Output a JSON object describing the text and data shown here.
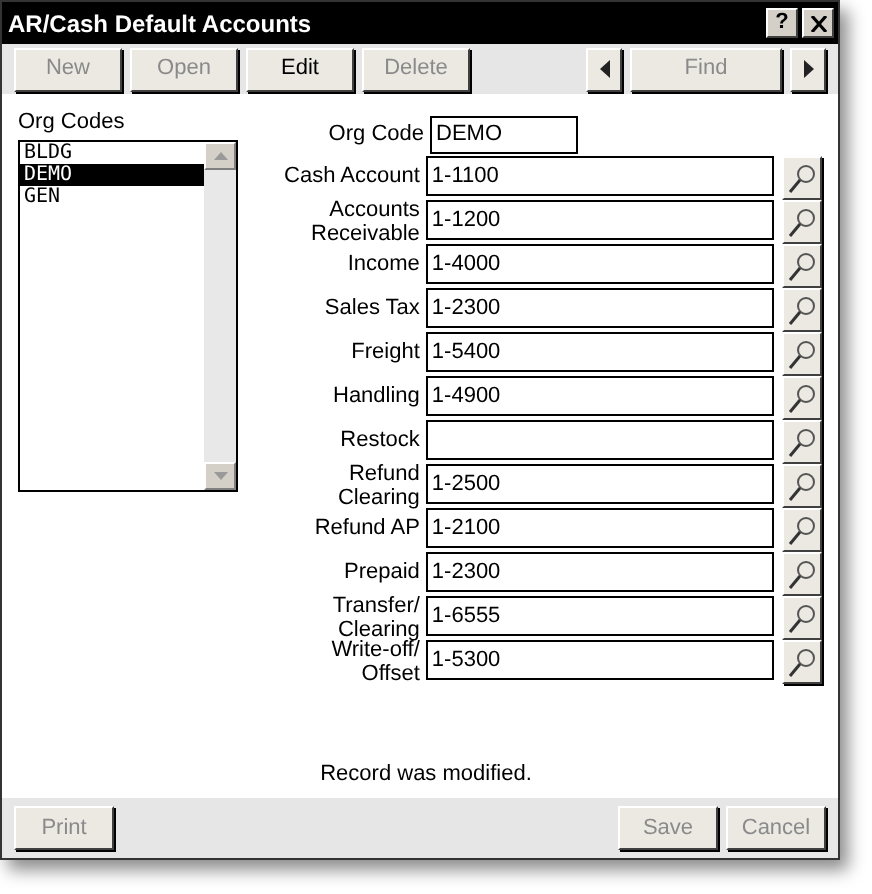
{
  "window": {
    "title": "AR/Cash Default Accounts",
    "help": "?"
  },
  "toolbar": [
    {
      "kind": "button",
      "label": "New",
      "disabled": true
    },
    {
      "kind": "button",
      "label": "Open",
      "disabled": true
    },
    {
      "kind": "button",
      "label": "Edit",
      "disabled": false
    },
    {
      "kind": "button",
      "label": "Delete",
      "disabled": true
    },
    {
      "kind": "spacer"
    },
    {
      "kind": "prev",
      "disabled": false
    },
    {
      "kind": "button",
      "label": "Find",
      "disabled": true
    },
    {
      "kind": "next",
      "disabled": false
    }
  ],
  "org_codes": {
    "label": "Org Codes",
    "items": [
      {
        "label": "BLDG",
        "selected": false
      },
      {
        "label": "DEMO",
        "selected": true
      },
      {
        "label": "GEN",
        "selected": false
      }
    ]
  },
  "org_code": {
    "label": "Org Code",
    "value": "DEMO"
  },
  "accounts": [
    {
      "label": "Cash Account",
      "value": "1-1100"
    },
    {
      "label": "Accounts Receivable",
      "value": "1-1200"
    },
    {
      "label": "Income",
      "value": "1-4000"
    },
    {
      "label": "Sales Tax",
      "value": "1-2300"
    },
    {
      "label": "Freight",
      "value": "1-5400"
    },
    {
      "label": "Handling",
      "value": "1-4900"
    },
    {
      "label": "Restock"
    },
    {
      "label": "Refund Clearing",
      "value": "1-2500"
    },
    {
      "label": "Refund AP",
      "value": "1-2100"
    },
    {
      "label": "Prepaid",
      "value": "1-2300"
    },
    {
      "label": "Transfer/ Clearing",
      "value": "1-6555"
    },
    {
      "label": "Write-off/ Offset",
      "value": "1-5300"
    }
  ],
  "status": "Record was modified.",
  "footer": {
    "left": [
      {
        "label": "Print",
        "disabled": true
      }
    ],
    "right": [
      {
        "label": "Save",
        "disabled": true
      },
      {
        "label": "Cancel",
        "disabled": true
      }
    ]
  }
}
